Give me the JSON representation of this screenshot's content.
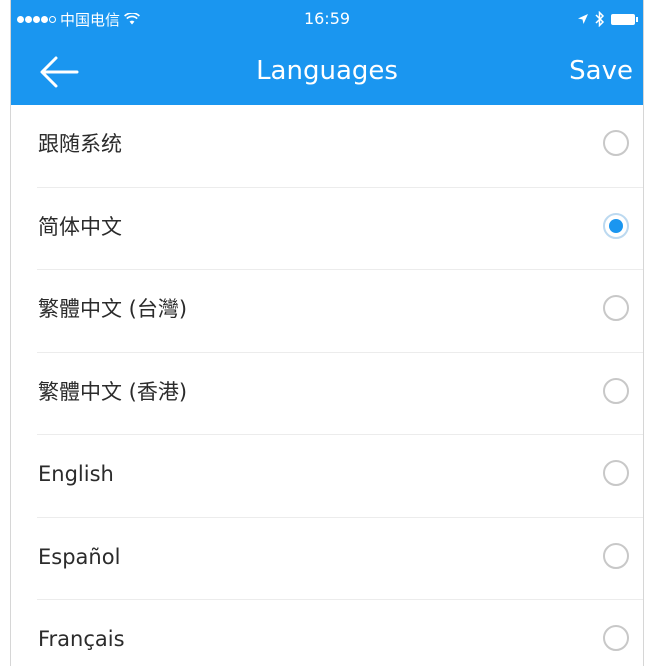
{
  "status_bar": {
    "carrier": "中国电信",
    "time": "16:59"
  },
  "nav": {
    "title": "Languages",
    "save_label": "Save"
  },
  "languages": [
    {
      "label": "跟随系统",
      "selected": false
    },
    {
      "label": "简体中文",
      "selected": true
    },
    {
      "label": "繁體中文 (台灣)",
      "selected": false
    },
    {
      "label": "繁體中文 (香港)",
      "selected": false
    },
    {
      "label": "English",
      "selected": false
    },
    {
      "label": "Español",
      "selected": false
    },
    {
      "label": "Français",
      "selected": false
    }
  ],
  "colors": {
    "accent": "#1a96f0",
    "text": "#2b2b2b",
    "radio_border": "#c8c8c8"
  }
}
